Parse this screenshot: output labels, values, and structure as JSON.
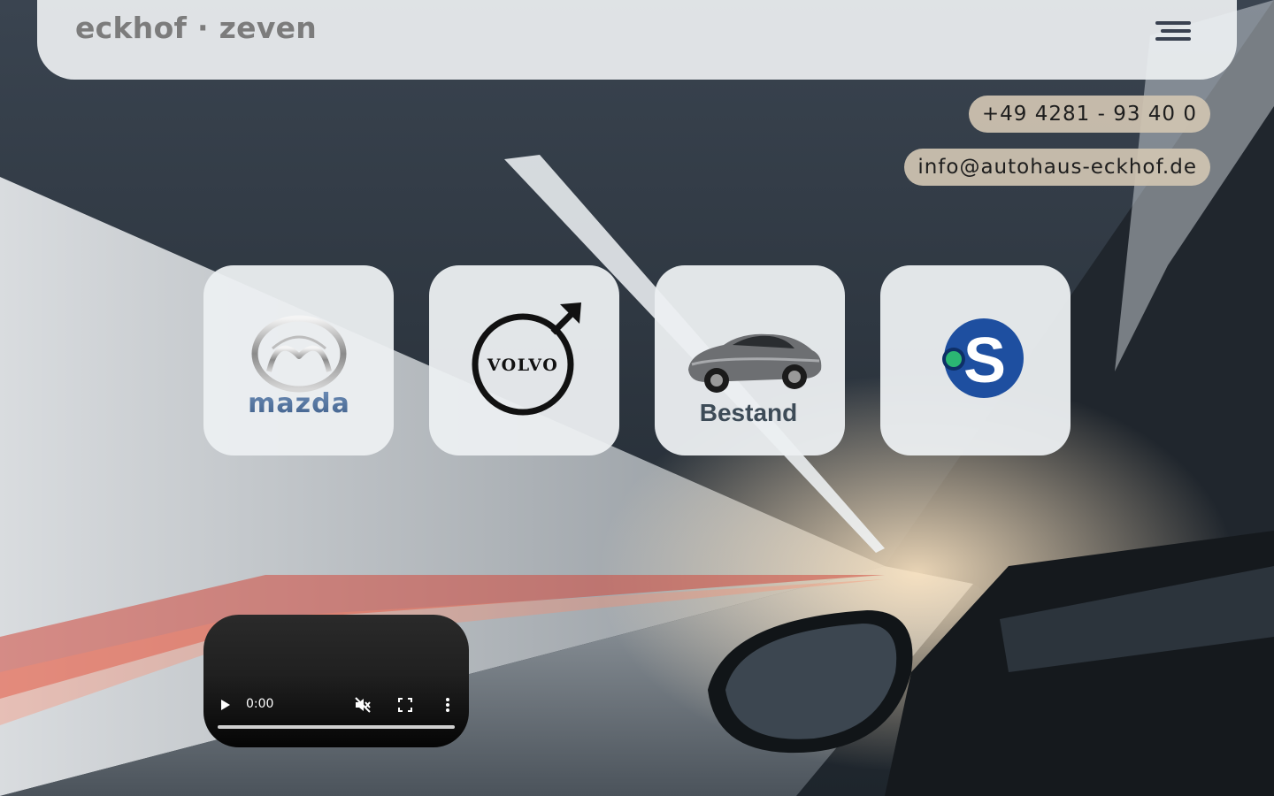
{
  "header": {
    "brand": "eckhof · zeven",
    "menu_icon": "hamburger-menu-icon"
  },
  "contact": {
    "phone": "+49 4281 - 93 40 0",
    "email": "info@autohaus-eckhof.de"
  },
  "tiles": [
    {
      "id": "mazda",
      "label": "mazda",
      "icon": "mazda-logo"
    },
    {
      "id": "volvo",
      "label": "VOLVO",
      "icon": "volvo-logo"
    },
    {
      "id": "bestand",
      "label": "Bestand",
      "icon": "sports-car-image"
    },
    {
      "id": "s",
      "label": "S",
      "icon": "s-brand-logo"
    }
  ],
  "video": {
    "time": "0:00",
    "controls": [
      "play-icon",
      "mute-icon",
      "fullscreen-icon",
      "more-options-icon"
    ]
  },
  "colors": {
    "header_bg": "#eceff1",
    "brand_text": "#7c7c7c",
    "pill_bg": "#d0c4b2",
    "tile_bg": "#eceff1",
    "s_logo_blue": "#1e4fa0",
    "s_logo_dot": "#2bb673"
  }
}
